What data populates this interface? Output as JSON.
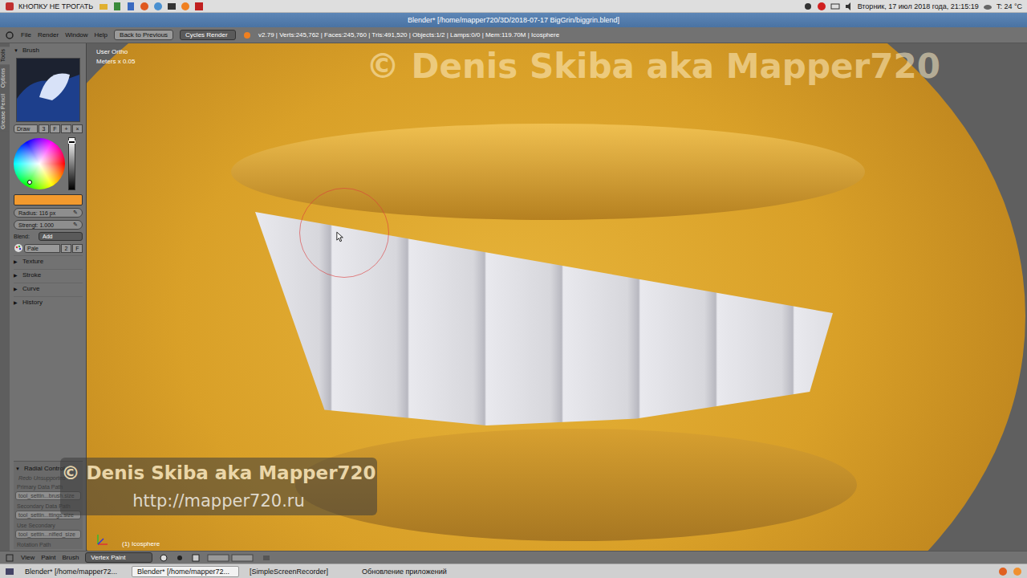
{
  "system_bar": {
    "launcher": "КНОПКУ НЕ ТРОГАТЬ",
    "datetime": "Вторник, 17 июл 2018 года, 21:15:19",
    "temperature": "T: 24 °C"
  },
  "window": {
    "title": "Blender* [/home/mapper720/3D/2018-07-17 BigGrin/biggrin.blend]"
  },
  "info_header": {
    "menus": [
      "File",
      "Render",
      "Window",
      "Help"
    ],
    "back_button": "Back to Previous",
    "engine": "Cycles Render",
    "stats": "v2.79 | Verts:245,762 | Faces:245,760 | Tris:491,520 | Objects:1/2 | Lamps:0/0 | Mem:119.70M | Icosphere"
  },
  "tool_shelf": {
    "tabs": [
      {
        "label": "Tools",
        "selected": true
      },
      {
        "label": "Options",
        "selected": false
      },
      {
        "label": "Grease Pencil",
        "selected": false
      }
    ],
    "brush_panel": {
      "title": "Brush",
      "expanded": true,
      "brush_name": "Draw",
      "users": "3",
      "fake_user": "F",
      "add": "+",
      "remove": "×",
      "color": "#f39a2e",
      "value_level": 0.95,
      "radius": "Radius: 116 px",
      "strength": "Strengt: 1.000",
      "blend_label": "Blend:",
      "blend": "Add",
      "palette": "Pale",
      "palette_users": "2",
      "palette_fake": "F"
    },
    "sections": [
      {
        "label": "Texture",
        "expanded": false
      },
      {
        "label": "Stroke",
        "expanded": false
      },
      {
        "label": "Curve",
        "expanded": false
      },
      {
        "label": "History",
        "expanded": false
      }
    ]
  },
  "operator_panel": {
    "title": "Radial Control",
    "expanded": true,
    "items": [
      {
        "text": "Redo Unsupported",
        "kind": "note",
        "disabled": true
      },
      {
        "text": "Primary Data Path",
        "kind": "label",
        "disabled": true
      },
      {
        "text": "tool_settin...brush.size",
        "kind": "field",
        "disabled": true
      },
      {
        "text": "Secondary Data Path",
        "kind": "label",
        "disabled": true
      },
      {
        "text": "tool_settin...ttings.size",
        "kind": "field",
        "disabled": true
      },
      {
        "text": "Use Secondary",
        "kind": "label",
        "disabled": true
      },
      {
        "text": "tool_settin...nified_size",
        "kind": "field",
        "disabled": true
      },
      {
        "text": "Rotation Path",
        "kind": "label",
        "disabled": true
      }
    ]
  },
  "viewport": {
    "view_name": "User Ortho",
    "scale": "Meters x 0.05",
    "object": "(1) Icosphere"
  },
  "watermarks": {
    "top": "© Denis Skiba aka Mapper720",
    "box_title": "© Denis Skiba aka Mapper720",
    "box_url": "http://mapper720.ru"
  },
  "bottom_header": {
    "menus": [
      "View",
      "Paint",
      "Brush"
    ],
    "mode": "Vertex Paint"
  },
  "taskbar": [
    {
      "label": "Blender* [/home/mapper72...",
      "selected": false
    },
    {
      "label": "Blender* [/home/mapper72...",
      "selected": true
    },
    {
      "label": "[SimpleScreenRecorder]",
      "selected": false
    },
    {
      "label": "Обновление приложений",
      "selected": false
    }
  ]
}
